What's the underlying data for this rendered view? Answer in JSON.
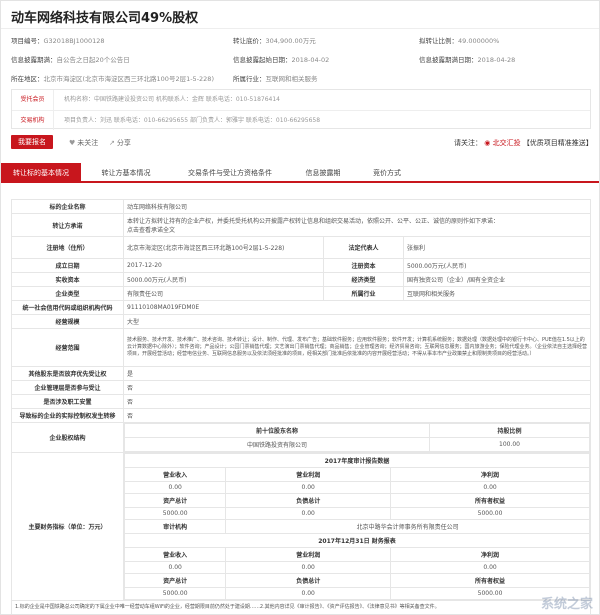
{
  "title": "动车网络科技有限公司49%股权",
  "meta": {
    "row1": [
      {
        "label": "项目编号：",
        "value": "G32018BJ1000128"
      },
      {
        "label": "转让底价：",
        "value": "304,900.00万元"
      },
      {
        "label": "拟转让比例：",
        "value": "49.000000%"
      }
    ],
    "row2": [
      {
        "label": "信息披露期满：",
        "value": "自公告之日起20个公告日"
      },
      {
        "label": "信息披露起始日期：",
        "value": "2018-04-02"
      },
      {
        "label": "信息披露期满日期：",
        "value": "2018-04-28"
      }
    ],
    "row3": [
      {
        "label": "所在地区：",
        "value": "北京市海淀区(北京市海淀区西三环北路100号2层1-5-228)"
      },
      {
        "label": "所属行业：",
        "value": "互联网和相关服务"
      }
    ]
  },
  "contacts": {
    "seller_label": "受托会员",
    "seller_text": "机构名称：中国铁路建设投资公司   机构联系人：金辉   联系电话：010-51876414",
    "trade_label": "交易机构",
    "trade_text": "项目负责人：刘迅   联系电话：010-66295655   部门负责人：郭雅宇   联系电话：010-66295658"
  },
  "actions": {
    "report": "我要报名",
    "follow": "未关注",
    "share": "分享",
    "note_prefix": "请关注：",
    "note_red": "北交汇投",
    "note_suffix": "【优质项目精准推送】"
  },
  "tabs": [
    "转让标的基本情况",
    "转让方基本情况",
    "交易条件与受让方资格条件",
    "信息披露期",
    "竞价方式"
  ],
  "info": {
    "target_name_k": "标的企业名称",
    "target_name_v": "动车网络科技有限公司",
    "commit_k": "转让方承诺",
    "commit_v": "本转让方拟转让持有的企业产权，并委托受托机构公开披露产权转让信息和组织交易活动，依照公开、公平、公正、诚信的原则作如下承诺：",
    "commit_link": "点击查看承诺全文",
    "addr_k": "注册地（住所）",
    "addr_v": "北京市海淀区(北京市海淀区西三环北路100号2层1-5-228)",
    "legal_k": "法定代表人",
    "legal_v": "张振利",
    "found_k": "成立日期",
    "found_v": "2017-12-20",
    "regcap_k": "注册资本",
    "regcap_v": "5000.00万元(人民币)",
    "paid_k": "实收资本",
    "paid_v": "5000.00万元(人民币)",
    "econ_k": "经济类型",
    "econ_v": "国有独资公司（企业）/国有全资企业",
    "type_k": "企业类型",
    "type_v": "有限责任公司",
    "ind_k": "所属行业",
    "ind_v": "互联网和相关服务",
    "credit_k": "统一社会信用代码或组织机构代码",
    "credit_v": "91110108MA019FDM0E",
    "scale_k": "经营规模",
    "scale_v": "大型",
    "scope_k": "经营范围",
    "scope_v": "技术服务、技术开发、技术推广、技术咨询、技术转让；设计、制作、代理、发布广告；基础软件服务；应用软件服务；软件开发；计算机系统服务；数据处理（数据处理中的银行卡中心、PUE值在1.5以上的云计算数据中心除外）；软件咨询；产品设计；公园门票销售代理；文艺演出门票销售代理；商品销售；企业管理咨询；经济贸易咨询；互联网信息服务；国内旅游业务；保险代理业务。（企业依法自主选择经营项目，开展经营活动；经营电信业务、互联网信息服务以及依法须经批准的项目，经相关部门批准后依批准的内容开展经营活动；不得从事本市产业政策禁止和限制类项目的经营活动。）",
    "pref_k": "其他股东是否放弃优先受让权",
    "pref_v": "是",
    "staff_k": "企业管理层是否参与受让",
    "staff_v": "否",
    "emp_k": "是否涉及职工安置",
    "emp_v": "否",
    "control_k": "导致标的企业的实际控制权发生转移",
    "control_v": "否",
    "holder_k": "企业股权结构",
    "holder_h1": "前十位股东名称",
    "holder_h2": "持股比例",
    "holder_name": "中国铁路投资有限公司",
    "holder_pct": "100.00",
    "fin_k": "主要财务指标（单位：万元）",
    "audit_title": "2017年度审计报告数据",
    "rev_h": "营业收入",
    "op_h": "营业利润",
    "net_h": "净利润",
    "a_rev": "0.00",
    "a_op": "0.00",
    "a_net": "0.00",
    "asset_h": "资产总计",
    "liab_h": "负债总计",
    "equity_h": "所有者权益",
    "a_asset": "5000.00",
    "a_liab": "0.00",
    "a_equity": "5000.00",
    "auditor_h": "审计机构",
    "auditor_v": "北京中路华会计师事务所有限责任公司",
    "rep_title": "2017年12月31日 财务报表",
    "r_rev": "0.00",
    "r_op": "0.00",
    "r_net": "0.00",
    "r_asset": "5000.00",
    "r_liab": "0.00",
    "r_equity": "5000.00",
    "foot_v": "1.标的企业是中国铁路总公司确定的下属企业中唯一经营动车组WiFi的企业，经营期限目前仍然处于建设期……2.其他内容详见《审计报告》、《资产评估报告》、《法律意见书》等相关备查文件。"
  },
  "watermark": "系统之家"
}
